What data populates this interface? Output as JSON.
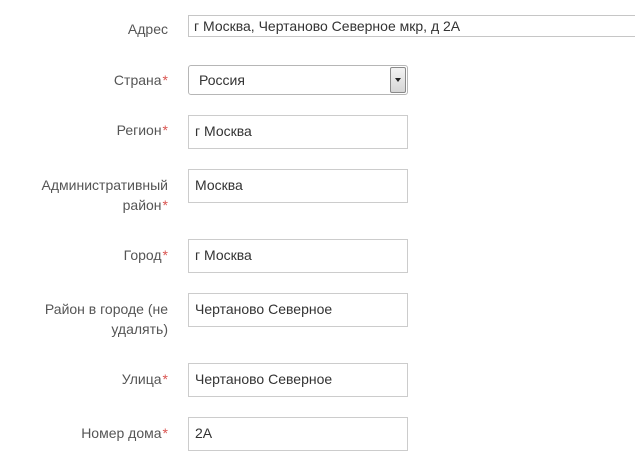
{
  "form": {
    "address": {
      "label": "Адрес",
      "value": "г Москва, Чертаново Северное мкр, д 2А"
    },
    "country": {
      "label": "Страна",
      "required_mark": "*",
      "selected": "Россия"
    },
    "region": {
      "label": "Регион",
      "required_mark": "*",
      "value": "г Москва"
    },
    "admin_district": {
      "label_line1": "Административный",
      "label_line2": "район",
      "required_mark": "*",
      "value": "Москва"
    },
    "city": {
      "label": "Город",
      "required_mark": "*",
      "value": "г Москва"
    },
    "city_district": {
      "label_line1": "Район в городе (не",
      "label_line2": "удалять)",
      "value": "Чертаново Северное"
    },
    "street": {
      "label": "Улица",
      "required_mark": "*",
      "value": "Чертаново Северное"
    },
    "house_number": {
      "label": "Номер дома",
      "required_mark": "*",
      "value": "2А"
    }
  },
  "colors": {
    "required": "#d9534f",
    "label_text": "#555555",
    "input_border": "#cccccc"
  }
}
